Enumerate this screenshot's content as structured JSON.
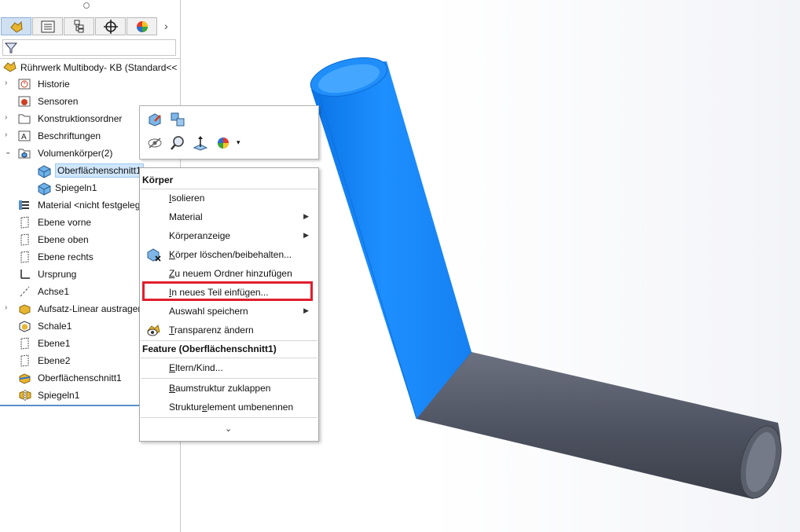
{
  "panel": {
    "root_label": "Rührwerk Multibody- KB  (Standard<<",
    "tabs": [
      {
        "icon": "feature-manager-icon"
      },
      {
        "icon": "property-manager-icon"
      },
      {
        "icon": "configuration-manager-icon"
      },
      {
        "icon": "dimxpert-icon"
      },
      {
        "icon": "display-manager-icon"
      }
    ],
    "tree": [
      {
        "label": "Historie",
        "icon": "history-icon",
        "expand": "›"
      },
      {
        "label": "Sensoren",
        "icon": "sensor-icon",
        "expand": ""
      },
      {
        "label": "Konstruktionsordner",
        "icon": "folder-icon",
        "expand": "›"
      },
      {
        "label": "Beschriftungen",
        "icon": "annotation-icon",
        "expand": "›"
      },
      {
        "label": "Volumenkörper(2)",
        "icon": "solid-bodies-icon",
        "expand": "⌄"
      },
      {
        "label": "Oberflächenschnitt1",
        "icon": "body-icon",
        "expand": ""
      },
      {
        "label": "Spiegeln1",
        "icon": "body-icon",
        "expand": ""
      },
      {
        "label": "Material <nicht festgeleg",
        "icon": "material-icon",
        "expand": ""
      },
      {
        "label": "Ebene vorne",
        "icon": "plane-icon",
        "expand": ""
      },
      {
        "label": "Ebene oben",
        "icon": "plane-icon",
        "expand": ""
      },
      {
        "label": "Ebene rechts",
        "icon": "plane-icon",
        "expand": ""
      },
      {
        "label": "Ursprung",
        "icon": "origin-icon",
        "expand": ""
      },
      {
        "label": "Achse1",
        "icon": "axis-icon",
        "expand": ""
      },
      {
        "label": "Aufsatz-Linear austrager",
        "icon": "extrude-icon",
        "expand": "›"
      },
      {
        "label": "Schale1",
        "icon": "shell-icon",
        "expand": ""
      },
      {
        "label": "Ebene1",
        "icon": "plane-icon",
        "expand": ""
      },
      {
        "label": "Ebene2",
        "icon": "plane-icon",
        "expand": ""
      },
      {
        "label": "Oberflächenschnitt1",
        "icon": "surface-cut-icon",
        "expand": ""
      },
      {
        "label": "Spiegeln1",
        "icon": "mirror-icon",
        "expand": ""
      }
    ]
  },
  "menu": {
    "header1": "Körper",
    "header2": "Feature (Oberflächenschnitt1)",
    "isolieren": {
      "u": "I",
      "rest": "solieren"
    },
    "material": {
      "u": "",
      "rest": "Material"
    },
    "koerperanzeige": {
      "u": "",
      "rest": "Körperanzeige"
    },
    "loeschen": {
      "u": "K",
      "rest": "örper löschen/beibehalten..."
    },
    "ordner": {
      "u": "Z",
      "rest": "u neuem Ordner hinzufügen"
    },
    "neuesteil": {
      "u": "I",
      "rest": "n neues Teil einfügen..."
    },
    "auswahl": {
      "u": "",
      "rest": "Auswahl speichern"
    },
    "transparenz": {
      "u": "T",
      "rest": "ransparenz ändern"
    },
    "eltern": {
      "u": "E",
      "rest": "ltern/Kind..."
    },
    "baum": {
      "u": "B",
      "rest": "aumstruktur zuklappen"
    },
    "umbenennen": {
      "pre": "Struktur",
      "u": "e",
      "rest": "lement umbenennen"
    },
    "more": "⌄"
  },
  "colors": {
    "selected_body": "#1e90ff",
    "body_gray": "#565c6a",
    "highlight_box": "#e01e2e"
  }
}
